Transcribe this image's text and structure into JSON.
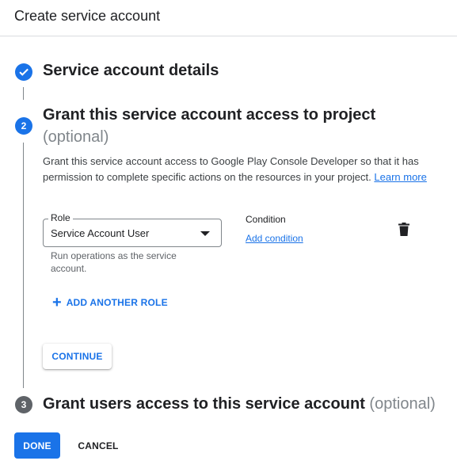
{
  "header": {
    "title": "Create service account"
  },
  "steps": [
    {
      "number": "",
      "title": "Service account details",
      "state": "complete",
      "icon": "check-icon"
    },
    {
      "number": "2",
      "title": "Grant this service account access to project",
      "optional": "(optional)",
      "state": "active"
    },
    {
      "number": "3",
      "title": "Grant users access to this service account",
      "optional": "(optional)",
      "state": "inactive"
    }
  ],
  "grant_access": {
    "description": "Grant this service account access to Google Play Console Developer so that it has permission to complete specific actions on the resources in your project.",
    "learn_more": "Learn more",
    "role": {
      "label": "Role",
      "value": "Service Account User",
      "hint": "Run operations as the service account."
    },
    "condition": {
      "label": "Condition",
      "add_label": "Add condition"
    },
    "add_another_role": "ADD ANOTHER ROLE",
    "continue_label": "CONTINUE"
  },
  "footer": {
    "done_label": "DONE",
    "cancel_label": "CANCEL"
  },
  "colors": {
    "accent": "#1a73e8",
    "inactive_step": "#5f6368",
    "divider": "#dadce0"
  }
}
